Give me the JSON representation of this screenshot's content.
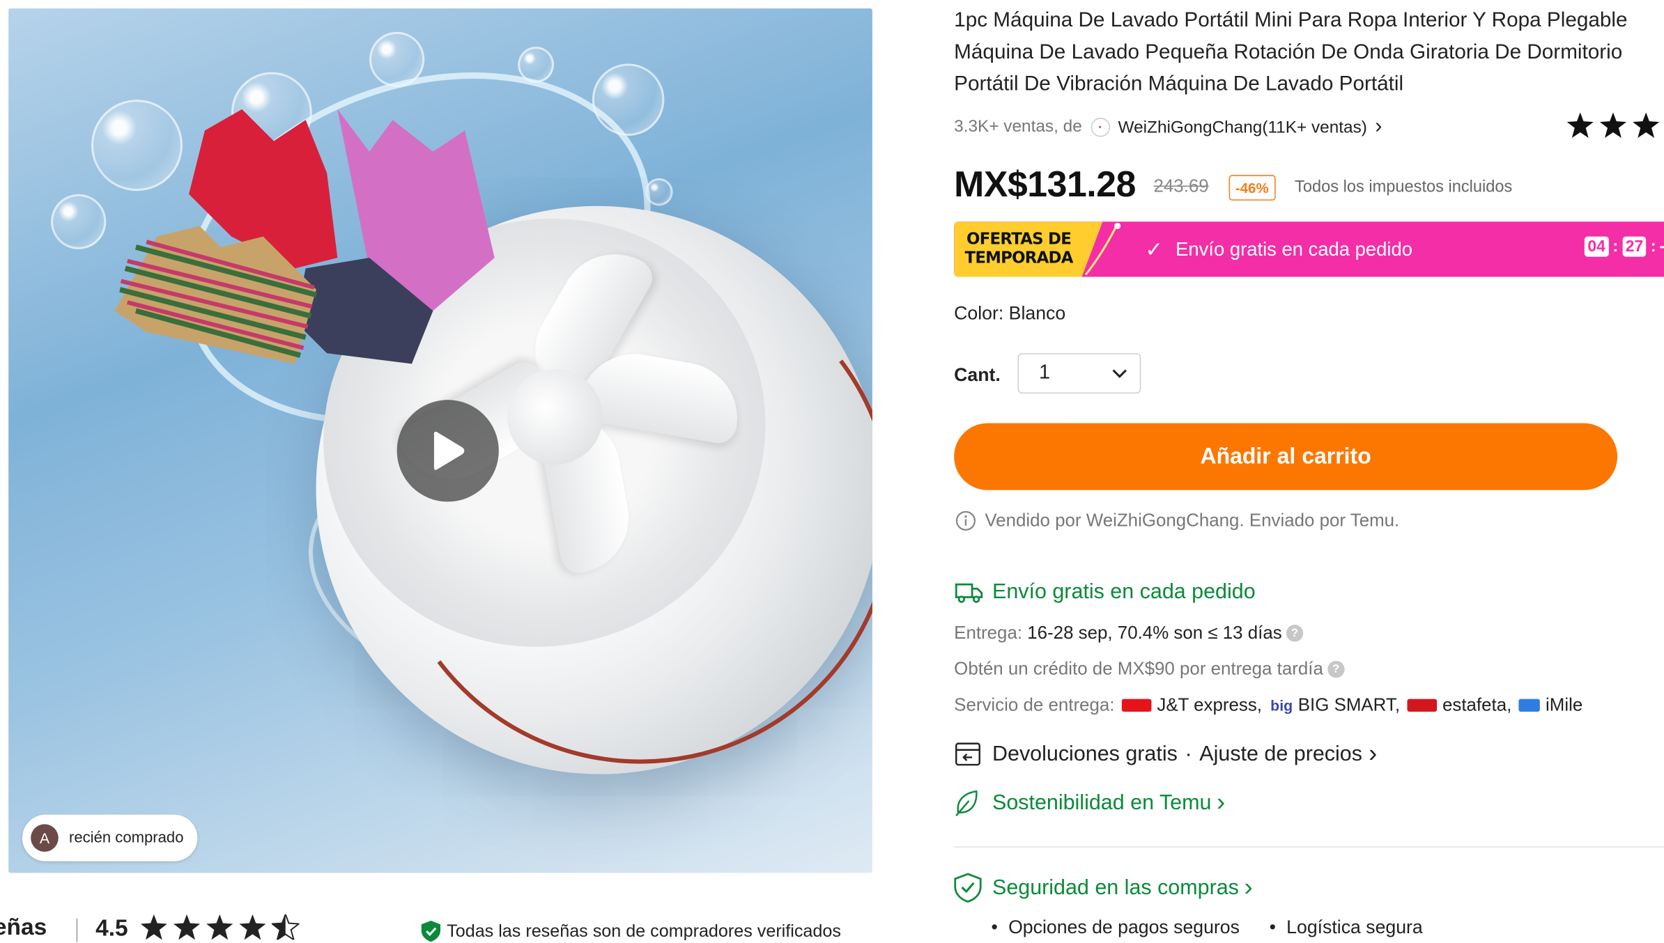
{
  "product": {
    "title_lines": [
      "1pc Máquina De Lavado Portátil Mini Para Ropa Interior Y Ropa Plegable",
      "Máquina De Lavado Pequeña Rotación De Onda Giratoria De Dormitorio",
      "Portátil De Vibración Máquina De Lavado Portátil"
    ],
    "sales": "3.3K+ ventas, de",
    "store_name": "WeiZhiGongChang(11K+ ventas)",
    "store_chevron": "›",
    "header_rating_stars": "★★★"
  },
  "pricing": {
    "price": "MX$131.28",
    "old_price": "243.69",
    "discount": "-46%",
    "tax_note": "Todos los impuestos incluidos"
  },
  "promo": {
    "season_label": "OFERTAS DE TEMPORADA",
    "free_shipping": "Envío gratis en cada pedido",
    "check_icon": "✓",
    "timer": [
      "04",
      "27",
      ""
    ]
  },
  "options": {
    "color_label": "Color: Blanco",
    "qty_label": "Cant.",
    "qty_value": "1"
  },
  "cart": {
    "add_label": "Añadir al carrito"
  },
  "seller_note": "Vendido por WeiZhiGongChang. Enviado por Temu.",
  "shipping": {
    "heading": "Envío gratis en cada pedido",
    "delivery_label": "Entrega:",
    "delivery_value": "16-28 sep, 70.4% son ≤ 13 días",
    "credit": "Obtén un crédito de MX$90 por entrega tardía",
    "service_label": "Servicio de entrega:",
    "carriers": [
      "J&T express,",
      "BIG SMART,",
      "estafeta,",
      "iMile"
    ],
    "carrier_logos": [
      "J&T",
      "big",
      "estafeta",
      "iMile"
    ]
  },
  "returns": {
    "label": "Devoluciones gratis",
    "dot": "·",
    "price_adjust": "Ajuste de precios",
    "chevron": "›"
  },
  "sustainability": {
    "label": "Sostenibilidad en Temu",
    "chevron": "›"
  },
  "security": {
    "label": "Seguridad en las compras",
    "chevron": "›",
    "items": [
      "Opciones de pagos seguros",
      "Logística segura"
    ]
  },
  "image_overlay": {
    "recent_avatar": "A",
    "recent_label": "recién comprado"
  },
  "reviews": {
    "heading": "eñas",
    "rating": "4.5",
    "rating_value": 4.5,
    "verified": "Todas las reseñas son de compradores verificados"
  },
  "colors": {
    "accent_orange": "#fb7701",
    "promo_pink": "#f32ea6",
    "promo_yellow": "#ffce2e",
    "green": "#0a8a3a"
  },
  "icons": [
    "play-icon",
    "star-icon",
    "shield-check-icon",
    "truck-icon",
    "info-icon",
    "return-box-icon",
    "leaf-icon",
    "chevron-down-icon",
    "check-icon"
  ]
}
